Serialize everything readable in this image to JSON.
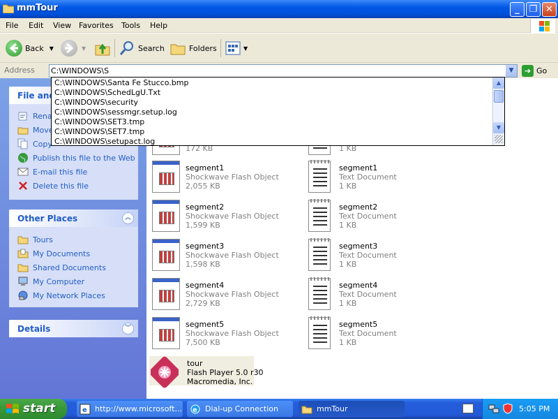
{
  "window": {
    "title": "mmTour"
  },
  "menu": [
    "File",
    "Edit",
    "View",
    "Favorites",
    "Tools",
    "Help"
  ],
  "toolbar": {
    "back": "Back",
    "search": "Search",
    "folders": "Folders"
  },
  "address": {
    "label": "Address",
    "value": "C:\\WINDOWS\\S",
    "go": "Go"
  },
  "autocomplete": [
    "C:\\WINDOWS\\Santa Fe Stucco.bmp",
    "C:\\WINDOWS\\SchedLgU.Txt",
    "C:\\WINDOWS\\security",
    "C:\\WINDOWS\\sessmgr.setup.log",
    "C:\\WINDOWS\\SET3.tmp",
    "C:\\WINDOWS\\SET7.tmp",
    "C:\\WINDOWS\\setupact.log"
  ],
  "tasks": {
    "title": "File and",
    "items": [
      "Rena",
      "Move",
      "Copy",
      "Publish this file to the Web",
      "E-mail this file",
      "Delete this file"
    ]
  },
  "other_places": {
    "title": "Other Places",
    "items": [
      "Tours",
      "My Documents",
      "Shared Documents",
      "My Computer",
      "My Network Places"
    ]
  },
  "details": {
    "title": "Details"
  },
  "files": {
    "partial": [
      {
        "size": "172 KB"
      },
      {
        "size": "1 KB"
      }
    ],
    "rows": [
      {
        "left": {
          "name": "segment1",
          "type": "Shockwave Flash Object",
          "size": "2,055 KB"
        },
        "right": {
          "name": "segment1",
          "type": "Text Document",
          "size": "1 KB"
        }
      },
      {
        "left": {
          "name": "segment2",
          "type": "Shockwave Flash Object",
          "size": "1,599 KB"
        },
        "right": {
          "name": "segment2",
          "type": "Text Document",
          "size": "1 KB"
        }
      },
      {
        "left": {
          "name": "segment3",
          "type": "Shockwave Flash Object",
          "size": "1,598 KB"
        },
        "right": {
          "name": "segment3",
          "type": "Text Document",
          "size": "1 KB"
        }
      },
      {
        "left": {
          "name": "segment4",
          "type": "Shockwave Flash Object",
          "size": "2,729 KB"
        },
        "right": {
          "name": "segment4",
          "type": "Text Document",
          "size": "1 KB"
        }
      },
      {
        "left": {
          "name": "segment5",
          "type": "Shockwave Flash Object",
          "size": "7,500 KB"
        },
        "right": {
          "name": "segment5",
          "type": "Text Document",
          "size": "1 KB"
        }
      }
    ],
    "tour": {
      "name": "tour",
      "type": "Flash Player 5.0 r30",
      "company": "Macromedia, Inc."
    }
  },
  "taskbar": {
    "start": "start",
    "buttons": [
      "http://www.microsoft....",
      "Dial-up Connection",
      "mmTour"
    ],
    "clock": "5:05 PM"
  }
}
